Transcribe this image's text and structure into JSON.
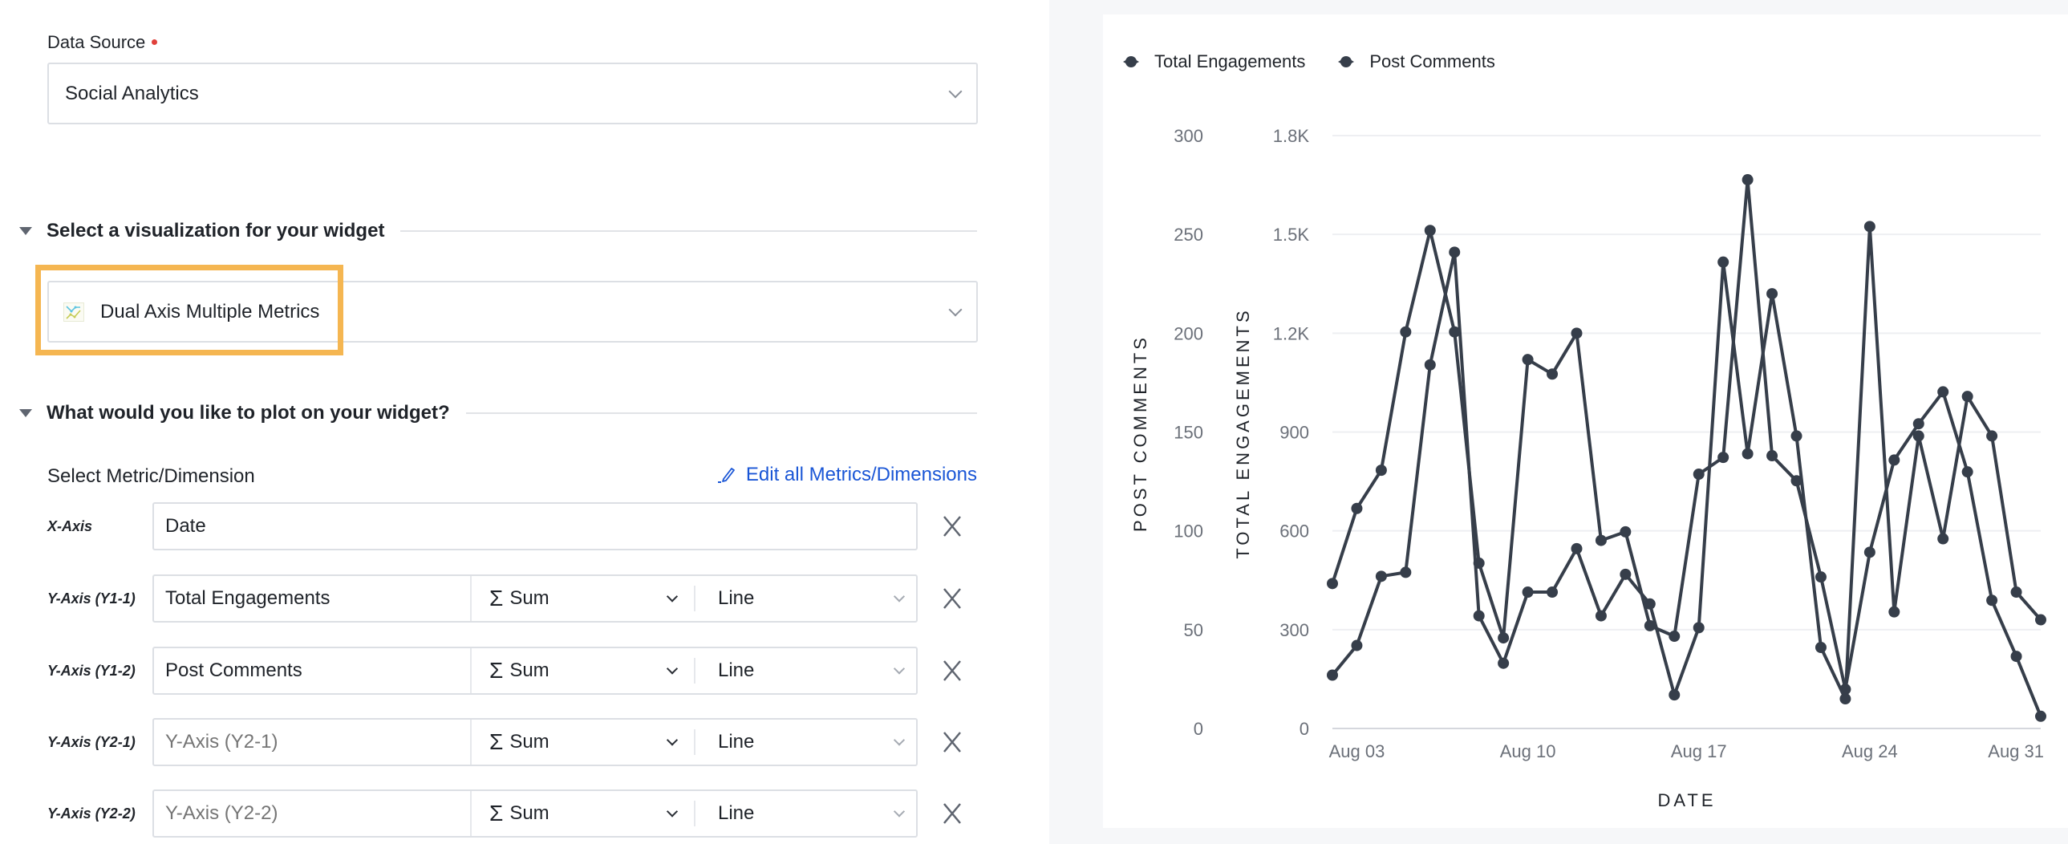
{
  "form": {
    "data_source_label": "Data Source",
    "data_source_value": "Social Analytics",
    "viz_section_title": "Select a visualization for your widget",
    "viz_value": "Dual Axis Multiple Metrics",
    "plot_section_title": "What would you like to plot on your widget?",
    "metric_label": "Select Metric/Dimension",
    "edit_link": "Edit all Metrics/Dimensions",
    "highlight_color": "#f5b651",
    "link_color": "#1a56d6",
    "rows": [
      {
        "label": "X-Axis",
        "value": "Date",
        "placeholder": "",
        "aggregation": "",
        "chart_type": ""
      },
      {
        "label": "Y-Axis (Y1-1)",
        "value": "Total Engagements",
        "placeholder": "",
        "aggregation": "Sum",
        "chart_type": "Line"
      },
      {
        "label": "Y-Axis (Y1-2)",
        "value": "Post Comments",
        "placeholder": "",
        "aggregation": "Sum",
        "chart_type": "Line"
      },
      {
        "label": "Y-Axis (Y2-1)",
        "value": "",
        "placeholder": "Y-Axis (Y2-1)",
        "aggregation": "Sum",
        "chart_type": "Line"
      },
      {
        "label": "Y-Axis (Y2-2)",
        "value": "",
        "placeholder": "Y-Axis (Y2-2)",
        "aggregation": "Sum",
        "chart_type": "Line"
      }
    ],
    "aggregation_symbol": "Σ"
  },
  "chart_data": {
    "type": "line",
    "title": "",
    "legend": [
      "Total Engagements",
      "Post Comments"
    ],
    "legend_position": "top-left",
    "line_color": "#363e4a",
    "xlabel": "DATE",
    "ylabel_left": "POST COMMENTS",
    "ylabel_right": "TOTAL ENGAGEMENTS",
    "x": [
      "Aug 02",
      "Aug 03",
      "Aug 04",
      "Aug 05",
      "Aug 06",
      "Aug 07",
      "Aug 08",
      "Aug 09",
      "Aug 10",
      "Aug 11",
      "Aug 12",
      "Aug 13",
      "Aug 14",
      "Aug 15",
      "Aug 16",
      "Aug 17",
      "Aug 18",
      "Aug 19",
      "Aug 20",
      "Aug 21",
      "Aug 22",
      "Aug 23",
      "Aug 24",
      "Aug 25",
      "Aug 26",
      "Aug 27",
      "Aug 28",
      "Aug 29",
      "Aug 30",
      "Aug 31"
    ],
    "x_tick_labels": [
      "Aug 03",
      "Aug 10",
      "Aug 17",
      "Aug 24",
      "Aug 31"
    ],
    "x_tick_index": [
      1,
      8,
      15,
      22,
      29
    ],
    "y_axis_post_comments": {
      "ticks": [
        "0",
        "50",
        "100",
        "150",
        "200",
        "250",
        "300"
      ],
      "range": [
        0,
        300
      ]
    },
    "y_axis_total_engagements": {
      "ticks": [
        "0",
        "300",
        "600",
        "900",
        "1.2K",
        "1.5K",
        "1.8K"
      ],
      "range": [
        0,
        1800
      ]
    },
    "grid": true,
    "series": [
      {
        "name": "Total Engagements",
        "axis": "total_engagements",
        "values": [
          440,
          668,
          784,
          1204,
          1512,
          1204,
          502,
          275,
          1120,
          1076,
          1200,
          571,
          597,
          312,
          280,
          772,
          823,
          1666,
          828,
          752,
          460,
          119,
          535,
          815,
          925,
          1022,
          779,
          389,
          219,
          37
        ]
      },
      {
        "name": "Post Comments",
        "axis": "post_comments",
        "values": [
          27,
          42,
          77,
          79,
          184,
          241,
          57,
          33,
          69,
          69,
          91,
          57,
          78,
          63,
          17,
          51,
          236,
          139,
          220,
          148,
          41,
          15,
          254,
          59,
          148,
          96,
          168,
          148,
          69,
          55
        ]
      }
    ]
  }
}
